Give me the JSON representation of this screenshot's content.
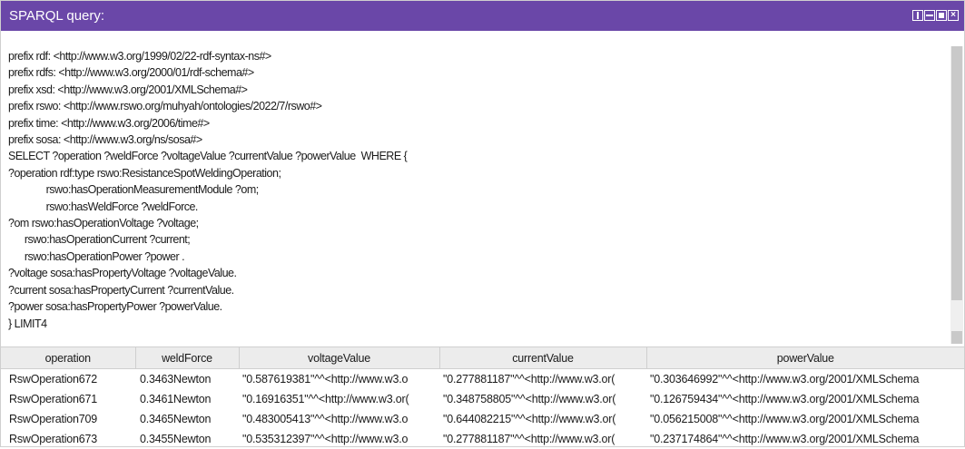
{
  "panel": {
    "title": "SPARQL query:",
    "controls": {
      "columns_icon": "columns-icon",
      "rows_icon": "rows-icon",
      "maximize_icon": "maximize-icon",
      "close_symbol": "×"
    },
    "accent_color": "#6a47a8"
  },
  "query": {
    "text": "prefix rdf: <http://www.w3.org/1999/02/22-rdf-syntax-ns#>\nprefix rdfs: <http://www.w3.org/2000/01/rdf-schema#>\nprefix xsd: <http://www.w3.org/2001/XMLSchema#>\nprefix rswo: <http://www.rswo.org/muhyah/ontologies/2022/7/rswo#>\nprefix time: <http://www.w3.org/2006/time#>\nprefix sosa: <http://www.w3.org/ns/sosa#>\nSELECT ?operation ?weldForce ?voltageValue ?currentValue ?powerValue  WHERE {\n?operation rdf:type rswo:ResistanceSpotWeldingOperation;\n              rswo:hasOperationMeasurementModule ?om;\n              rswo:hasWeldForce ?weldForce.\n?om rswo:hasOperationVoltage ?voltage;\n      rswo:hasOperationCurrent ?current;\n      rswo:hasOperationPower ?power .\n?voltage sosa:hasPropertyVoltage ?voltageValue.\n?current sosa:hasPropertyCurrent ?currentValue.\n?power sosa:hasPropertyPower ?powerValue.\n} LIMIT4"
  },
  "results": {
    "columns": [
      "operation",
      "weldForce",
      "voltageValue",
      "currentValue",
      "powerValue"
    ],
    "rows": [
      [
        "RswOperation672",
        "0.3463Newton",
        "\"0.587619381\"^^<http://www.w3.o",
        "\"0.277881187\"^^<http://www.w3.or(",
        "\"0.303646992\"^^<http://www.w3.org/2001/XMLSchema"
      ],
      [
        "RswOperation671",
        "0.3461Newton",
        "\"0.16916351\"^^<http://www.w3.or(",
        "\"0.348758805\"^^<http://www.w3.or(",
        "\"0.126759434\"^^<http://www.w3.org/2001/XMLSchema"
      ],
      [
        "RswOperation709",
        "0.3465Newton",
        "\"0.483005413\"^^<http://www.w3.o",
        "\"0.644082215\"^^<http://www.w3.or(",
        "\"0.056215008\"^^<http://www.w3.org/2001/XMLSchema"
      ],
      [
        "RswOperation673",
        "0.3455Newton",
        "\"0.535312397\"^^<http://www.w3.o",
        "\"0.277881187\"^^<http://www.w3.or(",
        "\"0.237174864\"^^<http://www.w3.org/2001/XMLSchema"
      ]
    ]
  }
}
